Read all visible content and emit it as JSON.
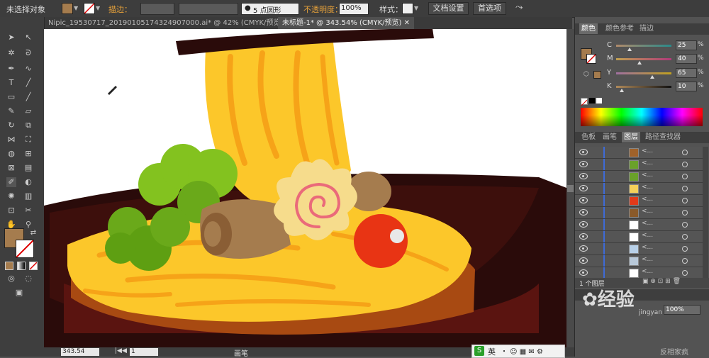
{
  "control_bar": {
    "selection_status": "未选择对象",
    "stroke_label": "描边：",
    "brush_size_label": "5 点圆形",
    "opacity_label": "不透明度：",
    "opacity_value": "100%",
    "style_label": "样式：",
    "document_setup_button": "文档设置",
    "preferences_button": "首选项"
  },
  "tabs": [
    {
      "label": "Nipic_19530717_20190105174324907000.ai* @ 42% (CMYK/预览)"
    },
    {
      "label": "未标题-1* @ 343.54% (CMYK/预览)"
    }
  ],
  "color_panel": {
    "tabs": [
      "颜色",
      "颜色参考",
      "描边"
    ],
    "channels": [
      {
        "name": "C",
        "value": "25"
      },
      {
        "name": "M",
        "value": "40"
      },
      {
        "name": "Y",
        "value": "65"
      },
      {
        "name": "K",
        "value": "10"
      }
    ],
    "percent_sign": "%"
  },
  "layers_panel": {
    "tabs": [
      "色板",
      "画笔",
      "图层",
      "路径查找器"
    ],
    "layer_count": "1 个图层",
    "layer_name": "<...",
    "rows": [
      {
        "color": "#a0622a"
      },
      {
        "color": "#6aa12a"
      },
      {
        "color": "#6aa12a"
      },
      {
        "color": "#f4d05a"
      },
      {
        "color": "#e23a1a"
      },
      {
        "color": "#8a5a2a"
      },
      {
        "color": "#ffffff"
      },
      {
        "color": "#ffffff"
      },
      {
        "color": "#b8d0e8"
      },
      {
        "color": "#b8c8d8"
      },
      {
        "color": "#ffffff"
      }
    ]
  },
  "status_bar": {
    "zoom": "343.54",
    "page": "1",
    "tool_name": "画笔"
  },
  "ime": {
    "label": "英"
  },
  "watermark": {
    "text": "经验",
    "sub": "jingyan"
  },
  "bottom_right_text": "反相家疯",
  "colors": {
    "fill": "#a57c4e",
    "noodle": "#fcc72a",
    "bowl": "#2a0b0a"
  }
}
